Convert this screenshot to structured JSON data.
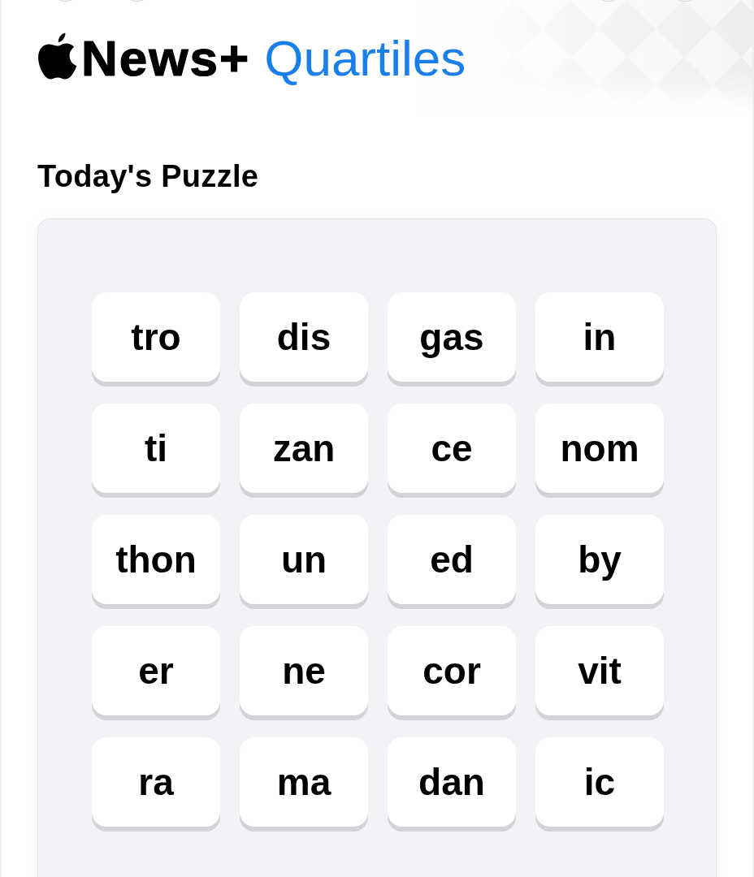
{
  "header": {
    "brand": "News+",
    "title": "Quartiles"
  },
  "section_title": "Today's Puzzle",
  "tiles": [
    [
      {
        "text": "tro",
        "selected": false
      },
      {
        "text": "dis",
        "selected": false
      },
      {
        "text": "gas",
        "selected": false
      },
      {
        "text": "in",
        "selected": false
      }
    ],
    [
      {
        "text": "ti",
        "selected": false
      },
      {
        "text": "zan",
        "selected": false
      },
      {
        "text": "ce",
        "selected": false
      },
      {
        "text": "nom",
        "selected": false
      }
    ],
    [
      {
        "text": "thon",
        "selected": false
      },
      {
        "text": "un",
        "selected": false
      },
      {
        "text": "ed",
        "selected": false
      },
      {
        "text": "by",
        "selected": false
      }
    ],
    [
      {
        "text": "er",
        "selected": false
      },
      {
        "text": "ne",
        "selected": false
      },
      {
        "text": "cor",
        "selected": false
      },
      {
        "text": "vit",
        "selected": false
      }
    ],
    [
      {
        "text": "ra",
        "selected": false
      },
      {
        "text": "ma",
        "selected": false
      },
      {
        "text": "dan",
        "selected": false
      },
      {
        "text": "ic",
        "selected": false
      }
    ]
  ]
}
